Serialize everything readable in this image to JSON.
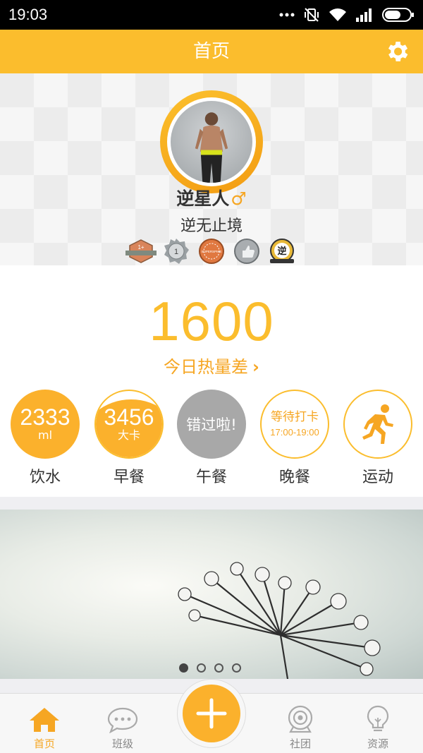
{
  "status_bar": {
    "time": "19:03",
    "icons": [
      "signal-dots-icon",
      "mute-vibrate-icon",
      "wifi-icon",
      "cell-signal-icon",
      "battery-icon"
    ]
  },
  "header": {
    "title": "首页",
    "settings_icon": "gear-icon",
    "accent_color": "#fbbd2d"
  },
  "profile": {
    "name": "逆星人",
    "gender_symbol": "♂",
    "motto": "逆无止境",
    "badges": [
      {
        "name": "hexagon-badge",
        "text": "1+"
      },
      {
        "name": "medal-badge",
        "text": "1"
      },
      {
        "name": "round-orange-badge",
        "text": "SUPERSPIKE"
      },
      {
        "name": "thumbs-up-badge",
        "text": ""
      },
      {
        "name": "logo-badge",
        "text": "逆"
      }
    ]
  },
  "calorie": {
    "value": "1600",
    "label": "今日热量差",
    "chevron": "›"
  },
  "meals": [
    {
      "key": "water",
      "label": "饮水",
      "value": "2333",
      "unit": "ml"
    },
    {
      "key": "breakfast",
      "label": "早餐",
      "value": "3456",
      "unit": "大卡"
    },
    {
      "key": "lunch",
      "label": "午餐",
      "status": "错过啦!"
    },
    {
      "key": "dinner",
      "label": "晚餐",
      "status": "等待打卡",
      "time": "17:00-19:00"
    },
    {
      "key": "exercise",
      "label": "运动",
      "icon": "running-person-icon"
    }
  ],
  "banner": {
    "pages": 4,
    "active_page": 1
  },
  "bottom_nav": {
    "items": [
      {
        "label": "首页",
        "icon": "home-icon",
        "active": true
      },
      {
        "label": "班级",
        "icon": "chat-bubble-icon",
        "active": false
      },
      {
        "label": "社团",
        "icon": "camera-icon",
        "active": false
      },
      {
        "label": "资源",
        "icon": "lightbulb-icon",
        "active": false
      }
    ],
    "fab_icon": "plus-icon"
  }
}
